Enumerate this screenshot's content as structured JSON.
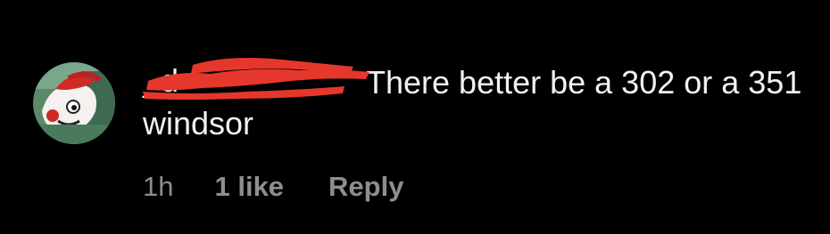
{
  "comment": {
    "username": "_d_",
    "text": "There better be a 302 or a 351 windsor",
    "timestamp": "1h",
    "likes_label": "1 like",
    "reply_label": "Reply"
  },
  "avatar": {
    "icon": "cartoon-character-avatar"
  },
  "colors": {
    "background": "#000000",
    "text": "#f2f2f2",
    "meta": "#8e8e8e",
    "redaction": "#e5372c"
  }
}
